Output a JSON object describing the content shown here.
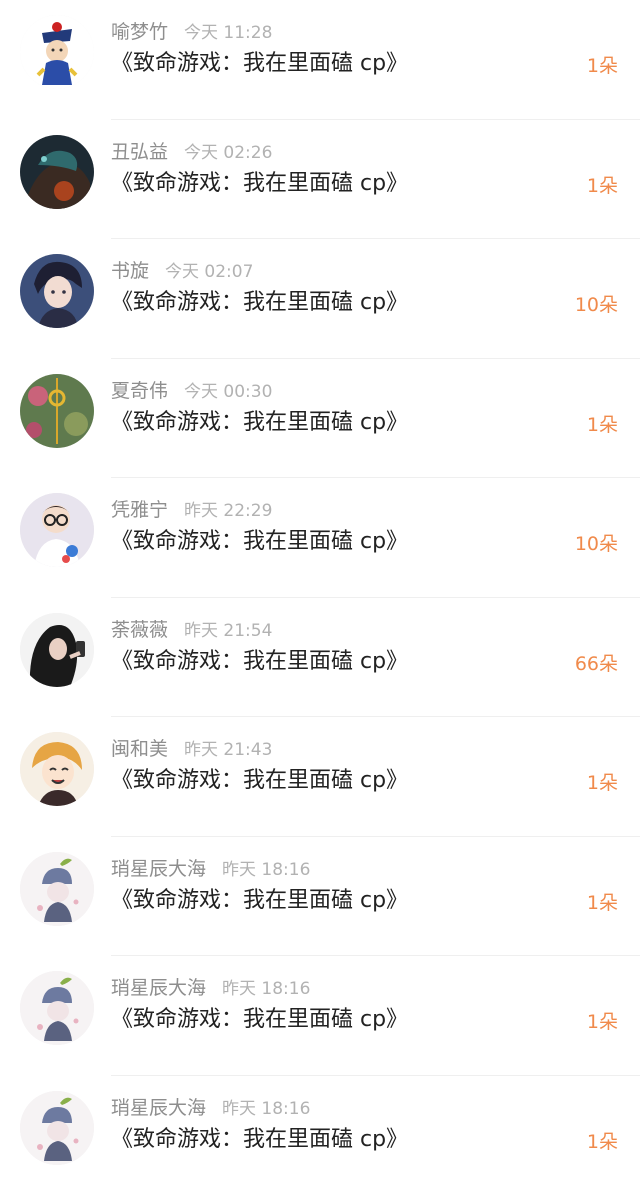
{
  "items": [
    {
      "name": "喻梦竹",
      "time": "今天 11:28",
      "title": "《致命游戏：我在里面磕 cp》",
      "amount": "1朵",
      "avatar_icon": "qing-official-cartoon-avatar-icon"
    },
    {
      "name": "丑弘益",
      "time": "今天 02:26",
      "title": "《致命游戏：我在里面磕 cp》",
      "amount": "1朵",
      "avatar_icon": "dark-fantasy-warrior-avatar-icon"
    },
    {
      "name": "书旋",
      "time": "今天 02:07",
      "title": "《致命游戏：我在里面磕 cp》",
      "amount": "10朵",
      "avatar_icon": "anime-boy-avatar-icon"
    },
    {
      "name": "夏奇伟",
      "time": "今天 00:30",
      "title": "《致命游戏：我在里面磕 cp》",
      "amount": "1朵",
      "avatar_icon": "flower-ornament-avatar-icon"
    },
    {
      "name": "凭雅宁",
      "time": "昨天 22:29",
      "title": "《致命游戏：我在里面磕 cp》",
      "amount": "10朵",
      "avatar_icon": "glasses-boy-avatar-icon"
    },
    {
      "name": "荼薇薇",
      "time": "昨天 21:54",
      "title": "《致命游戏：我在里面磕 cp》",
      "amount": "66朵",
      "avatar_icon": "girl-with-phone-avatar-icon"
    },
    {
      "name": "闽和美",
      "time": "昨天 21:43",
      "title": "《致命游戏：我在里面磕 cp》",
      "amount": "1朵",
      "avatar_icon": "smiling-anime-avatar-icon"
    },
    {
      "name": "琑星辰大海",
      "time": "昨天 18:16",
      "title": "《致命游戏：我在里面磕 cp》",
      "amount": "1朵",
      "avatar_icon": "chibi-hat-avatar-icon"
    },
    {
      "name": "琑星辰大海",
      "time": "昨天 18:16",
      "title": "《致命游戏：我在里面磕 cp》",
      "amount": "1朵",
      "avatar_icon": "chibi-hat-avatar-icon"
    },
    {
      "name": "琑星辰大海",
      "time": "昨天 18:16",
      "title": "《致命游戏：我在里面磕 cp》",
      "amount": "1朵",
      "avatar_icon": "chibi-hat-avatar-icon"
    }
  ],
  "colors": {
    "name": "#8e8e8e",
    "time": "#b2b2b2",
    "title": "#222222",
    "amount": "#f08a4b",
    "divider": "#efefef"
  }
}
